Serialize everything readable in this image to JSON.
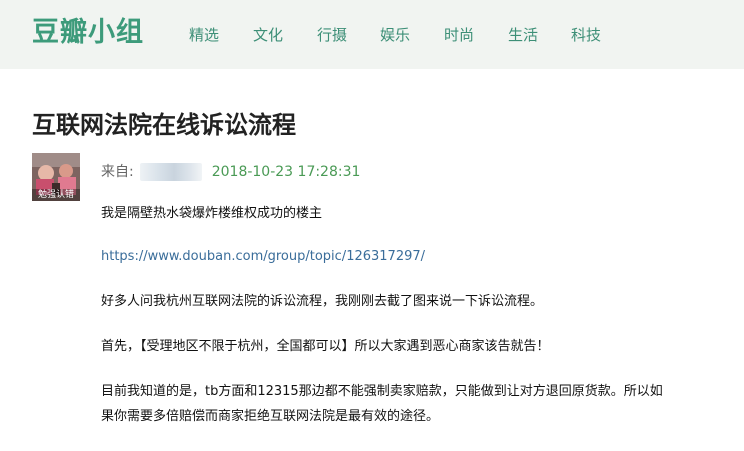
{
  "header": {
    "logo": "豆瓣小组",
    "nav": [
      "精选",
      "文化",
      "行摄",
      "娱乐",
      "时尚",
      "生活",
      "科技"
    ]
  },
  "topic": {
    "title": "互联网法院在线诉讼流程",
    "avatar_caption": "勉强认错",
    "from_label": "来自:",
    "timestamp": "2018-10-23 17:28:31"
  },
  "content": {
    "paragraphs": [
      "我是隔壁热水袋爆炸楼维权成功的楼主",
      "https://www.douban.com/group/topic/126317297/",
      "好多人问我杭州互联网法院的诉讼流程，我刚刚去截了图来说一下诉讼流程。",
      "首先，【受理地区不限于杭州，全国都可以】所以大家遇到恶心商家该告就告！",
      "目前我知道的是，tb方面和12315那边都不能强制卖家赔款，只能做到让对方退回原货款。所以如",
      "果你需要多倍赔偿而商家拒绝互联网法院是最有效的途径。"
    ]
  },
  "colors": {
    "brand": "#3d9b7b",
    "header_bg": "#f1f4f1",
    "link": "#3a6d9a",
    "timestamp": "#4a9a55"
  }
}
